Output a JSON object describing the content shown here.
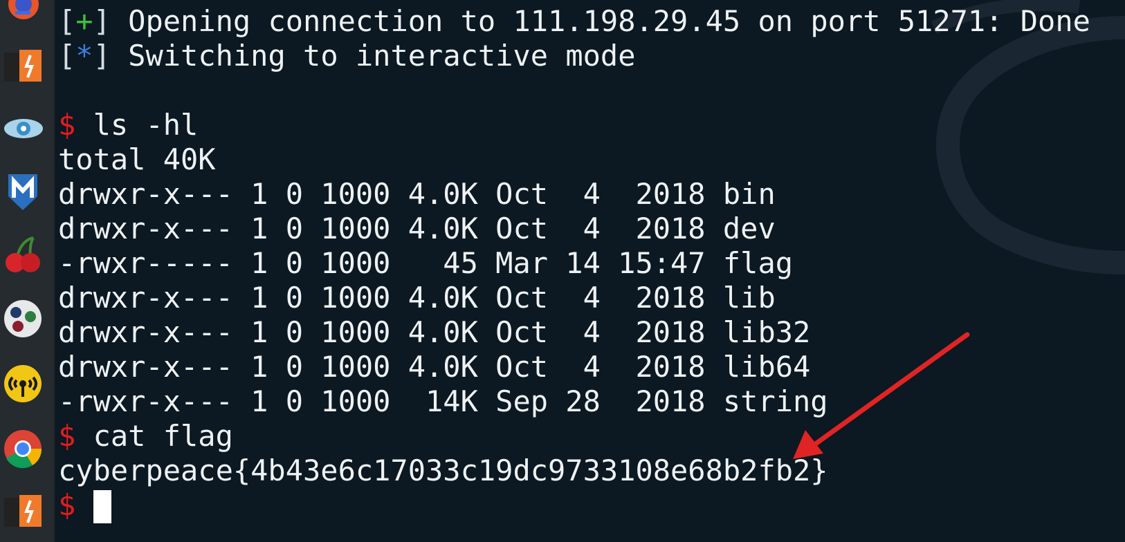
{
  "dock": {
    "icons": [
      "firefox-icon",
      "burpsuite-icon",
      "eye-icon",
      "metasploit-icon",
      "cherrytree-icon",
      "maltego-icon",
      "wifi-broadcast-icon",
      "chrome-icon",
      "burpsuite-icon"
    ]
  },
  "terminal": {
    "conn_status": {
      "bracket_open": "[",
      "symbol": "+",
      "bracket_close": "]",
      "text": " Opening connection to 111.198.29.45 on port 51271: Done"
    },
    "mode_status": {
      "bracket_open": "[",
      "symbol": "*",
      "bracket_close": "]",
      "text": " Switching to interactive mode"
    },
    "prompt_symbol": "$",
    "cmd_ls": " ls -hl",
    "ls_total": "total 40K",
    "ls_rows": [
      "drwxr-x--- 1 0 1000 4.0K Oct  4  2018 bin",
      "drwxr-x--- 1 0 1000 4.0K Oct  4  2018 dev",
      "-rwxr----- 1 0 1000   45 Mar 14 15:47 flag",
      "drwxr-x--- 1 0 1000 4.0K Oct  4  2018 lib",
      "drwxr-x--- 1 0 1000 4.0K Oct  4  2018 lib32",
      "drwxr-x--- 1 0 1000 4.0K Oct  4  2018 lib64",
      "-rwxr-x--- 1 0 1000  14K Sep 28  2018 string"
    ],
    "cmd_cat": " cat flag",
    "flag_output": "cyberpeace{4b43e6c17033c19dc9733108e68b2fb2}"
  },
  "colors": {
    "background": "#0c1822",
    "text": "#eef2f4",
    "prompt": "#e21d1d",
    "plus": "#3dbf3d",
    "star": "#3c7fd8",
    "annotation_arrow": "#e02424"
  }
}
